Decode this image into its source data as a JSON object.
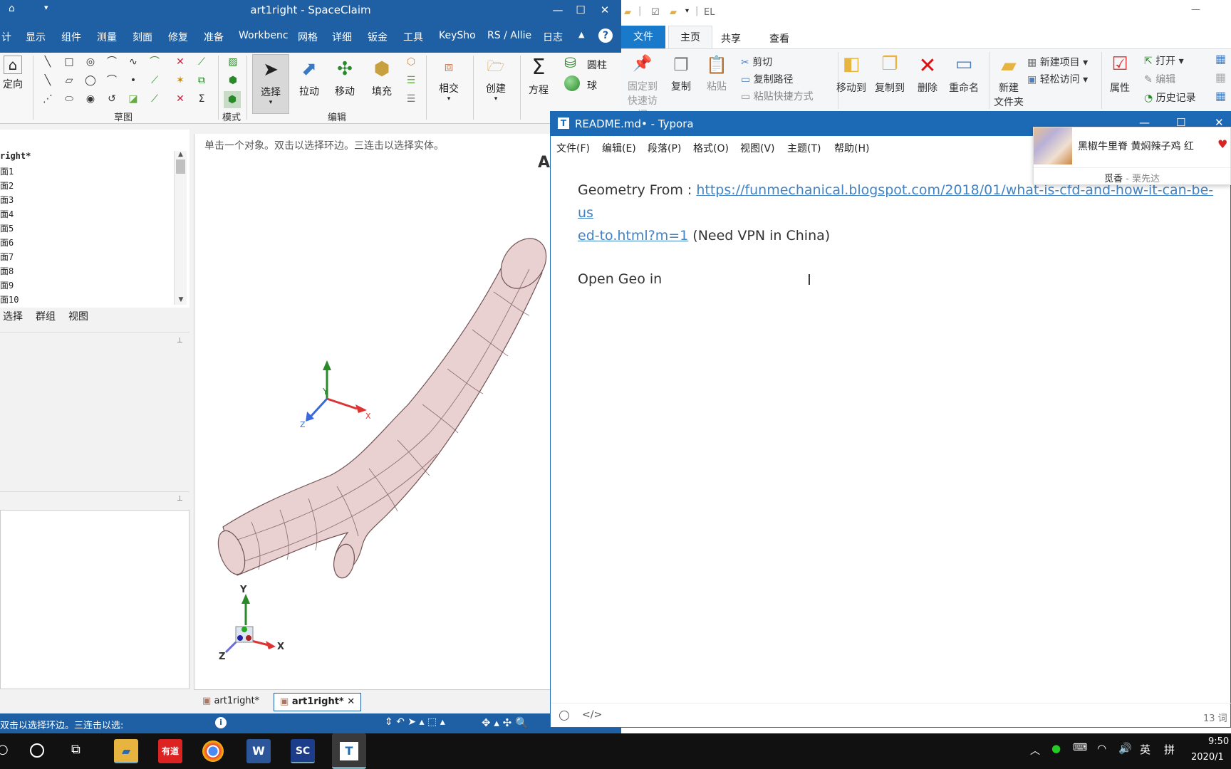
{
  "spaceclaim": {
    "title": "art1right - SpaceClaim",
    "tabs": [
      "计",
      "显示",
      "组件",
      "测量",
      "刻面",
      "修复",
      "准备",
      "Workbenc",
      "网格",
      "详细",
      "钣金",
      "工具",
      "KeySho",
      "RS / Allie",
      "日志"
    ],
    "ribbon": {
      "orient_label": "定向",
      "sketch_group": "草图",
      "mode_label": "模式",
      "select_label": "选择",
      "pull_label": "拉动",
      "move_label": "移动",
      "fill_label": "填充",
      "edit_group": "编辑",
      "intersect_label": "相交",
      "create_label": "创建",
      "equation_label": "方程",
      "cylinder_label": "圆柱",
      "sphere_label": "球"
    },
    "tree": {
      "root": "right*",
      "items": [
        "面1",
        "面2",
        "面3",
        "面4",
        "面5",
        "面6",
        "面7",
        "面8",
        "面9",
        "面10"
      ]
    },
    "panel_tabs": [
      "选择",
      "群组",
      "视图"
    ],
    "view_hint": "单击一个对象。双击以选择环边。三连击以选择实体。",
    "view_corner_letter": "A",
    "axis_labels": {
      "y": "Y",
      "x": "X",
      "z": "Z"
    },
    "doc_tabs": [
      "art1right*",
      "art1right*"
    ],
    "status_text": "双击以选择环边。三连击以选:"
  },
  "explorer": {
    "path_text": "EL",
    "tabs": [
      "文件",
      "主页",
      "共享",
      "查看"
    ],
    "pin_label": "固定到",
    "pin_label2": "快速访问",
    "copy_label": "复制",
    "paste_label": "粘贴",
    "cut_label": "剪切",
    "copy_path_label": "复制路径",
    "paste_shortcut_label": "粘贴快捷方式",
    "move_to_label": "移动到",
    "copy_to_label": "复制到",
    "delete_label": "删除",
    "rename_label": "重命名",
    "new_folder_label": "新建",
    "new_folder_label2": "文件夹",
    "new_item_label": "新建项目",
    "easy_access_label": "轻松访问",
    "properties_label": "属性",
    "open_label": "打开",
    "edit_label": "编辑",
    "history_label": "历史记录"
  },
  "typora": {
    "title": "README.md• - Typora",
    "menu": [
      "文件(F)",
      "编辑(E)",
      "段落(P)",
      "格式(O)",
      "视图(V)",
      "主题(T)",
      "帮助(H)"
    ],
    "line1_prefix": "Geometry From : ",
    "link_part1": "https://funmechanical.blogspot.com/2018/01/what-is-cfd-and-how-it-can-be-us",
    "link_part2": "ed-to.html?m=1",
    "line2_suffix": " (Need VPN in China)",
    "para2": "Open Geo in",
    "word_count": "13 词"
  },
  "notification": {
    "title": "黑椒牛里脊 黄焖辣子鸡 红",
    "source": "觅香",
    "author": "- 栗先达"
  },
  "taskbar": {
    "youdao_label": "有道",
    "word_label": "W",
    "sc_label": "SC",
    "typora_label": "T",
    "ime_label": "英",
    "ime_mode": "拼",
    "time": "9:50",
    "date": "2020/1"
  },
  "colors": {
    "accent": "#1f5fa3",
    "typora_blue": "#1c6ab5",
    "link": "#4183c4"
  }
}
